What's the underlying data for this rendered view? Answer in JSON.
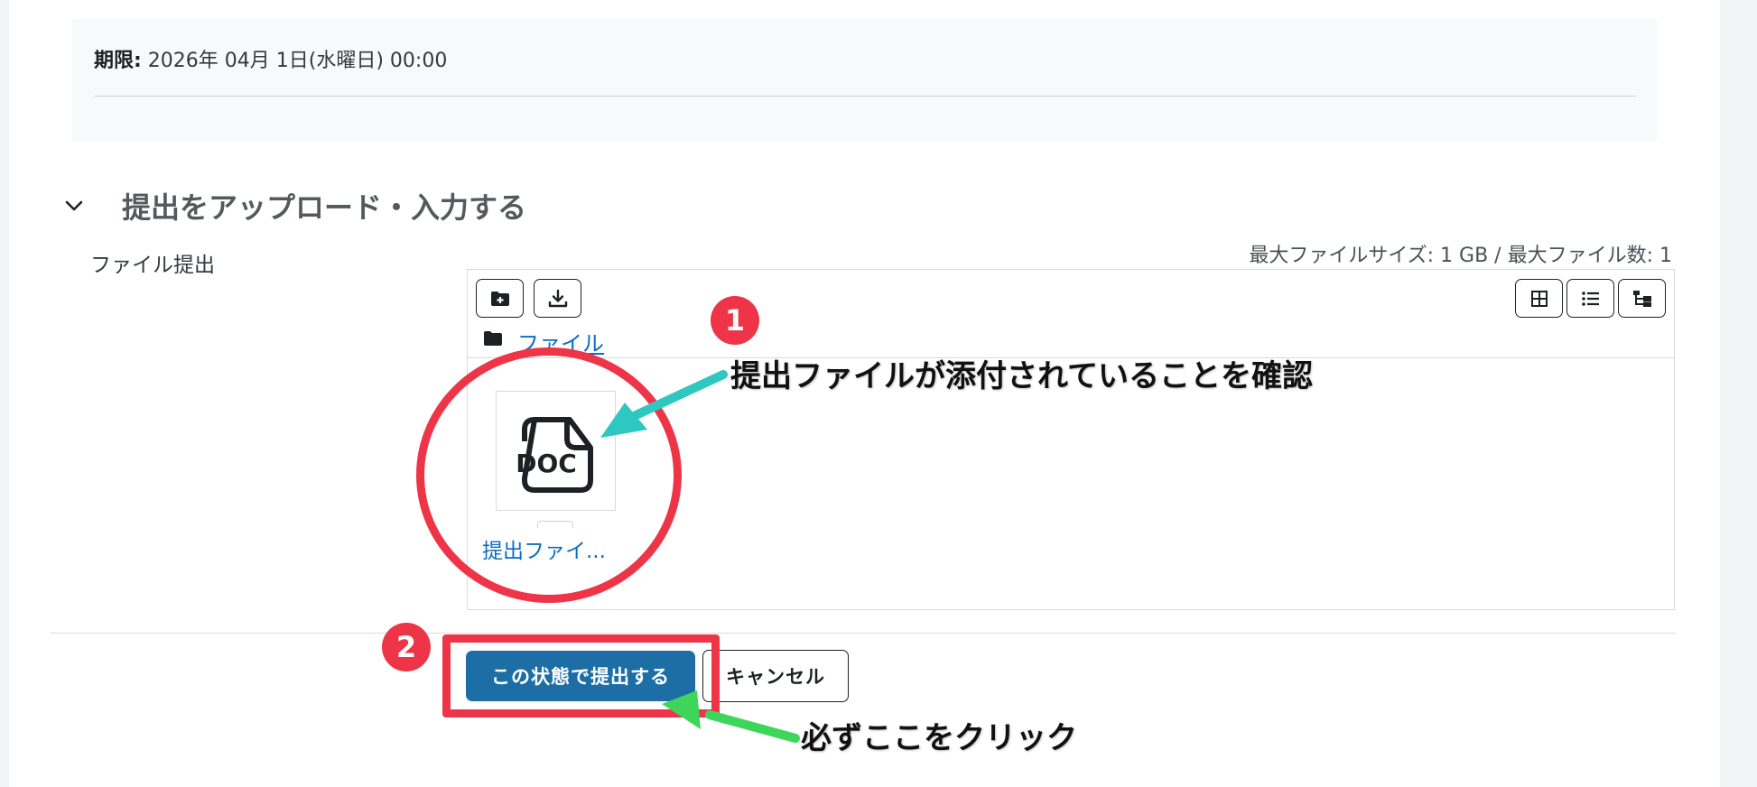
{
  "due": {
    "label": "期限:",
    "value": " 2026年 04月 1日(水曜日) 00:00"
  },
  "section": {
    "title": "提出をアップロード・入力する",
    "chevron_icon": "chevron-down-icon"
  },
  "file_submission": {
    "label": "ファイル提出",
    "limits": "最大ファイルサイズ: 1 GB / 最大ファイル数: 1"
  },
  "file_manager": {
    "left_buttons": [
      "add-file-icon",
      "download-all-icon"
    ],
    "view_buttons": [
      "grid-view-icon",
      "list-view-icon",
      "tree-view-icon"
    ],
    "path": "ファイル",
    "files": [
      {
        "name": "提出ファイ...",
        "type_label": "DOC",
        "icon": "doc-file-icon"
      }
    ]
  },
  "actions": {
    "submit_label": "この状態で提出する",
    "cancel_label": "キャンセル"
  },
  "annotations": {
    "step1_number": "1",
    "step1_text": "提出ファイルが添付されていることを確認",
    "step2_number": "2",
    "step2_text": "必ずここをクリック",
    "highlight_color": "#ee3547",
    "arrow1_color": "#2ec8c0",
    "arrow2_color": "#3ed65a"
  },
  "colors": {
    "primary": "#1c6ea4",
    "link": "#0f6cbf"
  }
}
